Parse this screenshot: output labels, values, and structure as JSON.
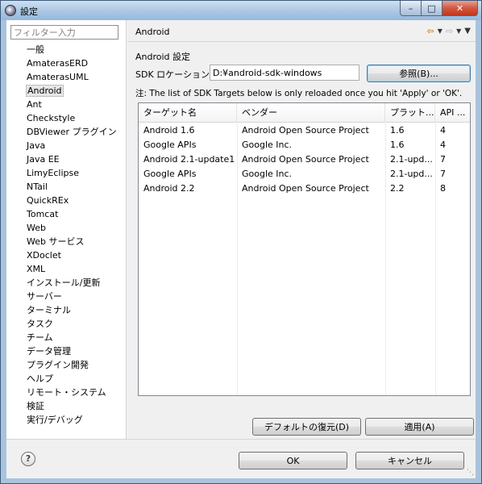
{
  "window": {
    "title": "設定"
  },
  "filter": {
    "placeholder": "フィルター入力"
  },
  "tree": [
    {
      "label": "一般"
    },
    {
      "label": "AmaterasERD"
    },
    {
      "label": "AmaterasUML"
    },
    {
      "label": "Android",
      "selected": true
    },
    {
      "label": "Ant"
    },
    {
      "label": "Checkstyle"
    },
    {
      "label": "DBViewer プラグイン"
    },
    {
      "label": "Java"
    },
    {
      "label": "Java EE"
    },
    {
      "label": "LimyEclipse"
    },
    {
      "label": "NTail"
    },
    {
      "label": "QuickREx"
    },
    {
      "label": "Tomcat"
    },
    {
      "label": "Web"
    },
    {
      "label": "Web サービス"
    },
    {
      "label": "XDoclet"
    },
    {
      "label": "XML"
    },
    {
      "label": "インストール/更新"
    },
    {
      "label": "サーバー"
    },
    {
      "label": "ターミナル"
    },
    {
      "label": "タスク"
    },
    {
      "label": "チーム"
    },
    {
      "label": "データ管理"
    },
    {
      "label": "プラグイン開発"
    },
    {
      "label": "ヘルプ"
    },
    {
      "label": "リモート・システム"
    },
    {
      "label": "検証"
    },
    {
      "label": "実行/デバッグ"
    }
  ],
  "header": {
    "title": "Android"
  },
  "section": {
    "title": "Android 設定"
  },
  "sdk": {
    "label": "SDK ロケーション:",
    "value": "D:¥android-sdk-windows",
    "browse_label": "参照(B)..."
  },
  "note": "注: The list of SDK Targets below is only reloaded once you hit 'Apply' or 'OK'.",
  "table": {
    "columns": [
      "ターゲット名",
      "ベンダー",
      "プラット...",
      "API ..."
    ],
    "rows": [
      [
        "Android 1.6",
        "Android Open Source Project",
        "1.6",
        "4"
      ],
      [
        "Google APIs",
        "Google Inc.",
        "1.6",
        "4"
      ],
      [
        "Android 2.1-update1",
        "Android Open Source Project",
        "2.1-upd...",
        "7"
      ],
      [
        "Google APIs",
        "Google Inc.",
        "2.1-upd...",
        "7"
      ],
      [
        "Android 2.2",
        "Android Open Source Project",
        "2.2",
        "8"
      ]
    ]
  },
  "buttons": {
    "restore_defaults": "デフォルトの復元(D)",
    "apply": "適用(A)",
    "ok": "OK",
    "cancel": "キャンセル",
    "help": "?"
  },
  "icons": {
    "back": "back-arrow-icon",
    "forward": "forward-arrow-icon",
    "menu": "view-menu-icon"
  }
}
